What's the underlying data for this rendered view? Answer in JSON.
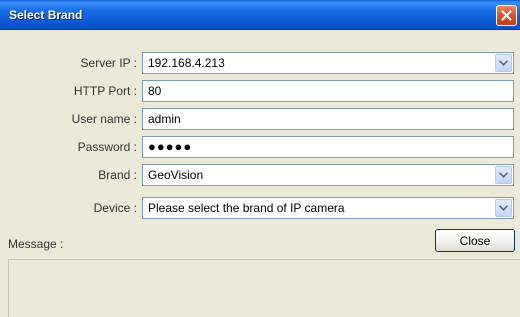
{
  "window": {
    "title": "Select Brand"
  },
  "form": {
    "server_ip": {
      "label": "Server IP :",
      "value": "192.168.4.213"
    },
    "http_port": {
      "label": "HTTP Port :",
      "value": "80"
    },
    "user_name": {
      "label": "User name :",
      "value": "admin"
    },
    "password": {
      "label": "Password :",
      "value": "●●●●●"
    },
    "brand": {
      "label": "Brand :",
      "value": "GeoVision"
    },
    "device": {
      "label": "Device :",
      "value": "Please select the brand of IP camera"
    }
  },
  "buttons": {
    "close_label": "Close"
  },
  "message": {
    "label": "Message :",
    "text": ""
  },
  "icons": {
    "title_close": "close-icon",
    "dropdown": "chevron-down-icon"
  }
}
